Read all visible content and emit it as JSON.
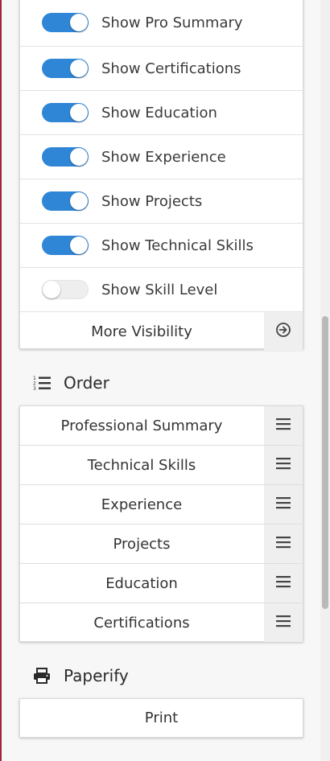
{
  "visibility": {
    "toggles": [
      {
        "label": "Show Pro Summary",
        "on": true
      },
      {
        "label": "Show Certifications",
        "on": true
      },
      {
        "label": "Show Education",
        "on": true
      },
      {
        "label": "Show Experience",
        "on": true
      },
      {
        "label": "Show Projects",
        "on": true
      },
      {
        "label": "Show Technical Skills",
        "on": true
      },
      {
        "label": "Show Skill Level",
        "on": false
      }
    ],
    "more_label": "More Visibility",
    "more_icon": "arrow-circle-right-icon"
  },
  "order": {
    "title": "Order",
    "icon": "ordered-list-icon",
    "items": [
      {
        "label": "Professional Summary"
      },
      {
        "label": "Technical Skills"
      },
      {
        "label": "Experience"
      },
      {
        "label": "Projects"
      },
      {
        "label": "Education"
      },
      {
        "label": "Certifications"
      }
    ],
    "handle_icon": "drag-handle-icon"
  },
  "paperify": {
    "title": "Paperify",
    "icon": "printer-icon",
    "print_label": "Print"
  },
  "colors": {
    "toggle_on": "#2f86d6",
    "toggle_off": "#eeeeee",
    "accent_edge": "#a0243c"
  }
}
